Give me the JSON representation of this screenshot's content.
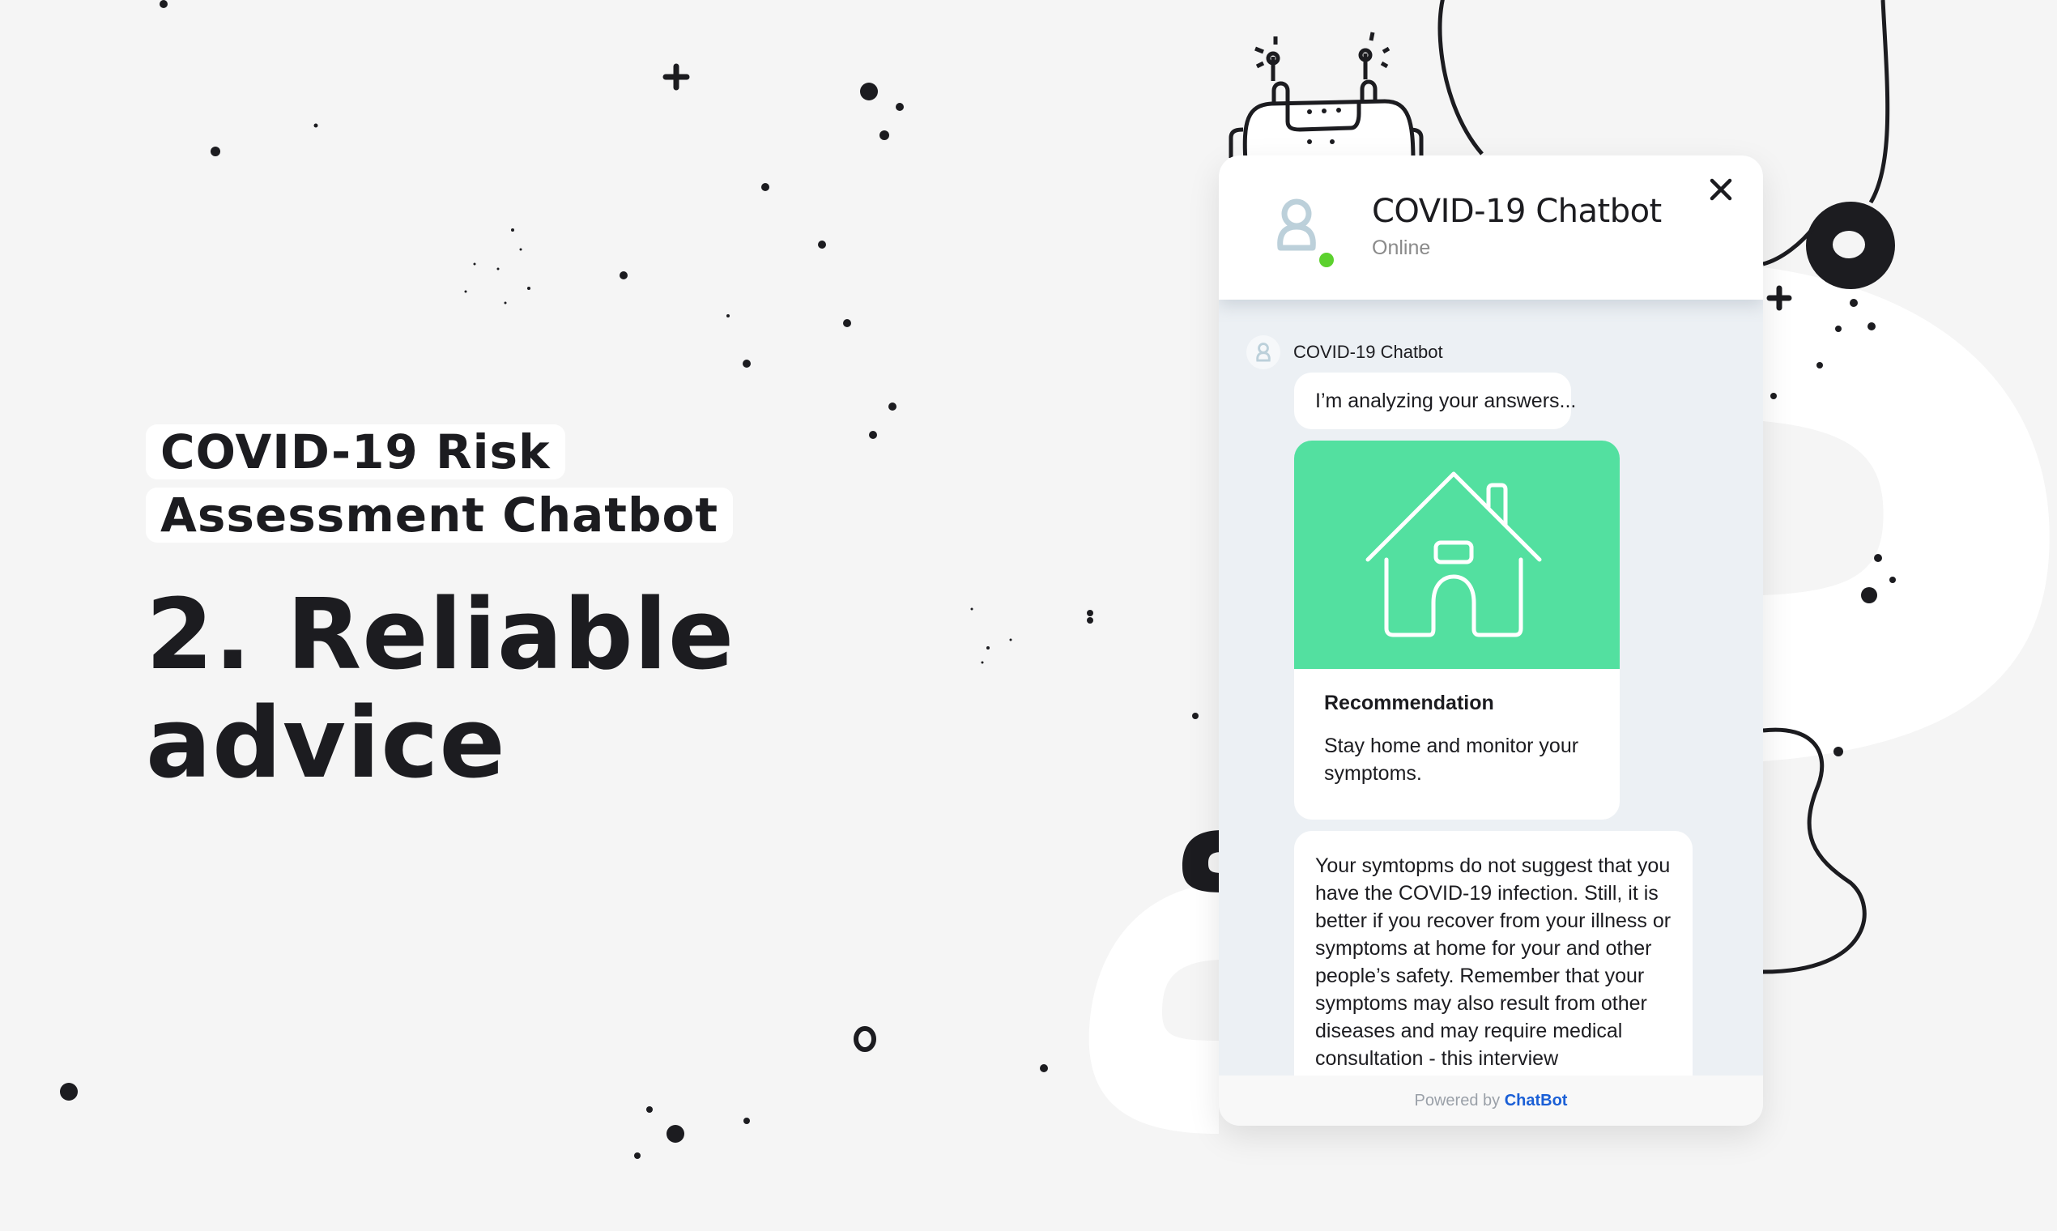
{
  "hero": {
    "title_line1": "COVID-19 Risk",
    "title_line2": "Assessment Chatbot",
    "headline_line1": "2. Reliable",
    "headline_line2": "advice"
  },
  "widget": {
    "header": {
      "bot_name": "COVID-19 Chatbot",
      "status": "Online",
      "status_color": "#5cd12e",
      "avatar_icon": "user-icon",
      "close_icon": "close-icon"
    },
    "messages": {
      "sender": "COVID-19 Chatbot",
      "analyzing": "I’m analyzing your answers...",
      "card": {
        "image_icon": "house-icon",
        "image_bg": "#53e0a0",
        "title": "Recommendation",
        "text": "Stay home and monitor your symptoms."
      },
      "advice": "Your symtopms do not suggest that you have the COVID-19 infection. Still, it is better if you recover from your illness or symptoms at home for your and other people’s safety. Remember that your symptoms may also result from other diseases and may require medical consultation - this interview"
    },
    "footer": {
      "powered_by": "Powered by",
      "brand": "ChatBot",
      "brand_color": "#1a5fd6"
    }
  }
}
